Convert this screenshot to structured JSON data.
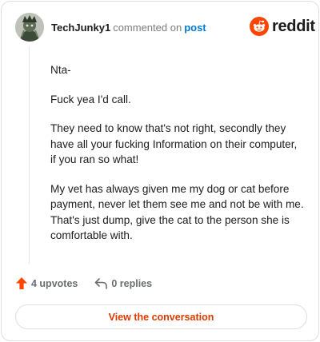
{
  "header": {
    "username": "TechJunky1",
    "commented_text": "commented on",
    "post_link": "post",
    "brand": "reddit"
  },
  "comment": {
    "paragraphs": [
      "Nta-",
      "Fuck yea I'd call.",
      "They need to know that's not right, secondly they have all your fucking Information on their computer, if you ran so what!",
      "My vet has always given me my dog or cat before payment, never let them see me and not be with me. That's just dump, give the cat to the person she is comfortable with."
    ]
  },
  "actions": {
    "upvotes": "4 upvotes",
    "replies": "0 replies"
  },
  "view_button": "View the conversation",
  "colors": {
    "accent": "#ff4500",
    "link": "#0079d3",
    "button_text": "#d93a00"
  },
  "icons": [
    "avatar-image",
    "reddit-logo-icon",
    "upvote-arrow-icon",
    "reply-icon"
  ]
}
